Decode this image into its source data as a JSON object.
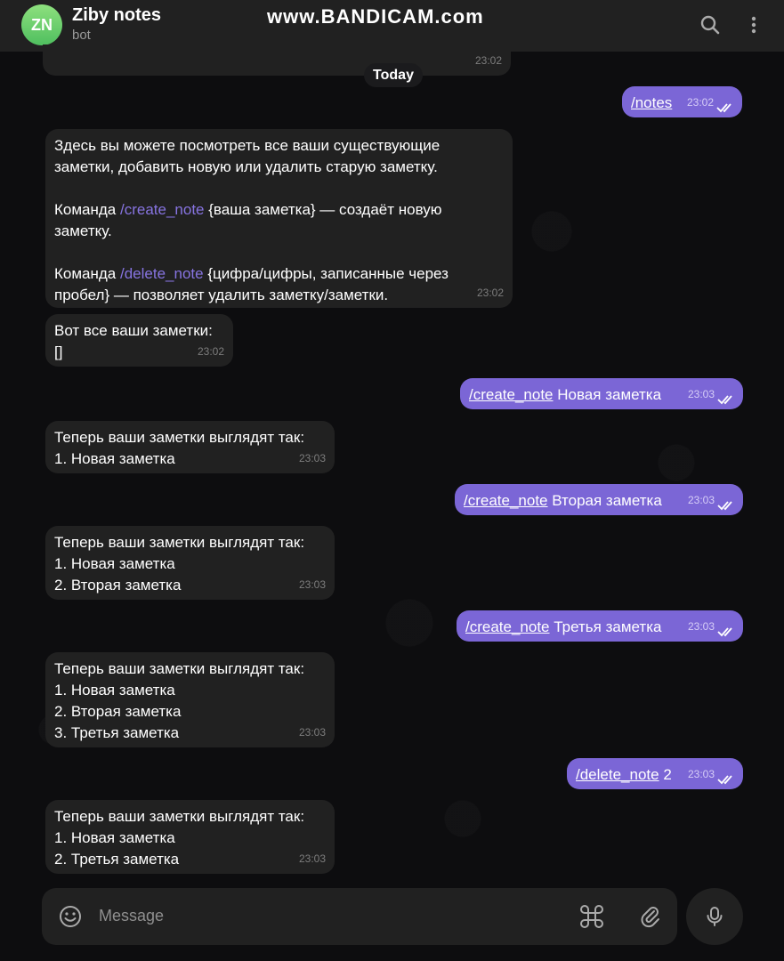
{
  "header": {
    "avatar_initials": "ZN",
    "title": "Ziby notes",
    "subtitle": "bot",
    "watermark": "www.BANDICAM.com",
    "search_icon": "search-icon",
    "menu_icon": "more-vertical-icon"
  },
  "date_chip": "Today",
  "partial_time": "23:02",
  "messages": [
    {
      "dir": "out",
      "cmd": "/notes",
      "text": "",
      "time": "23:02"
    },
    {
      "dir": "in",
      "time": "23:02",
      "intro1": "Здесь вы можете посмотреть все ваши существующие",
      "intro2": "заметки, добавить новую или удалить старую заметку.",
      "p2_prefix": "Команда ",
      "p2_cmd": "/create_note",
      "p2_rest": " {ваша заметка} — создаёт новую",
      "p2_line2": "заметку.",
      "p3_prefix": "Команда ",
      "p3_cmd": "/delete_note",
      "p3_rest": " {цифра/цифры, записанные через",
      "p3_line2": "пробел} — позволяет удалить заметку/заметки."
    },
    {
      "dir": "in",
      "time": "23:02",
      "line1": "Вот все ваши заметки:",
      "line2": "[]"
    },
    {
      "dir": "out",
      "cmd": "/create_note",
      "text": " Новая заметка",
      "time": "23:03"
    },
    {
      "dir": "in",
      "time": "23:03",
      "lines": [
        "Теперь ваши заметки выглядят так:",
        "1. Новая заметка"
      ]
    },
    {
      "dir": "out",
      "cmd": "/create_note",
      "text": " Вторая заметка",
      "time": "23:03"
    },
    {
      "dir": "in",
      "time": "23:03",
      "lines": [
        "Теперь ваши заметки выглядят так:",
        "1. Новая заметка",
        "2. Вторая заметка"
      ]
    },
    {
      "dir": "out",
      "cmd": "/create_note",
      "text": " Третья заметка",
      "time": "23:03"
    },
    {
      "dir": "in",
      "time": "23:03",
      "lines": [
        "Теперь ваши заметки выглядят так:",
        "1. Новая заметка",
        "2. Вторая заметка",
        "3. Третья заметка"
      ]
    },
    {
      "dir": "out",
      "cmd": "/delete_note",
      "text": " 2",
      "time": "23:03"
    },
    {
      "dir": "in",
      "time": "23:03",
      "lines": [
        "Теперь ваши заметки выглядят так:",
        "1. Новая заметка",
        "2. Третья заметка"
      ]
    }
  ],
  "composer": {
    "placeholder": "Message",
    "emoji_icon": "emoji-icon",
    "commands_icon": "bot-commands-icon",
    "attach_icon": "paperclip-icon",
    "mic_icon": "microphone-icon"
  },
  "colors": {
    "outgoing": "#7b66d6",
    "incoming": "#212121",
    "command_link": "#8774e1"
  }
}
